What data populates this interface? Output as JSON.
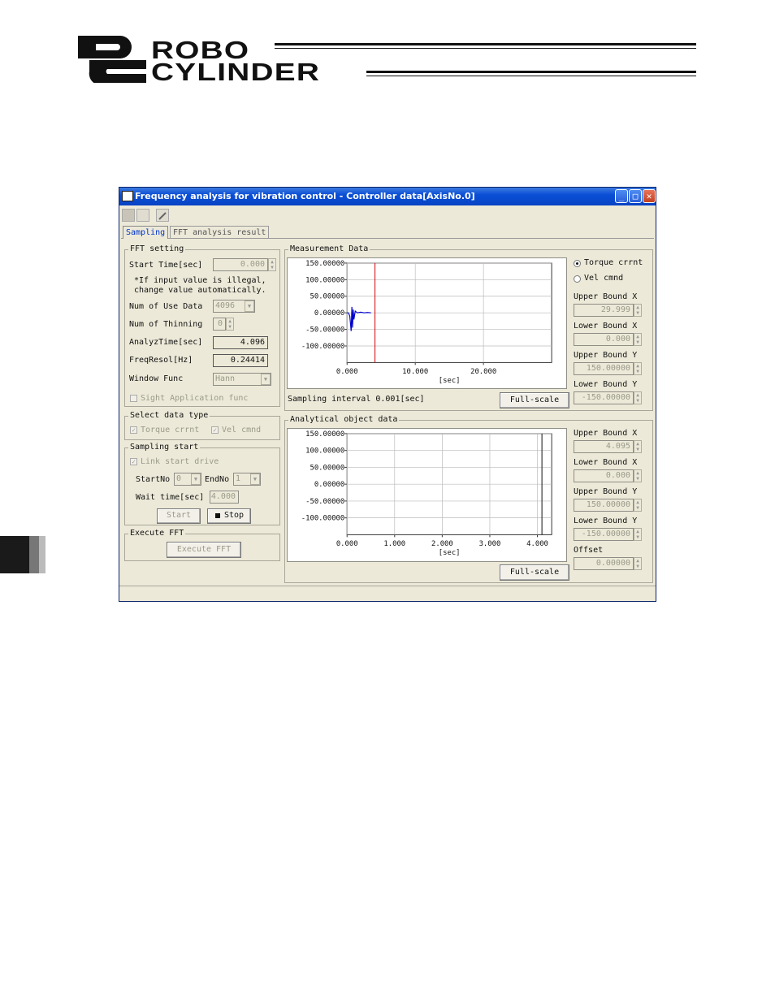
{
  "header": {
    "logo_line1": "ROBO",
    "logo_line2": "CYLINDER"
  },
  "window": {
    "title": "Frequency analysis for vibration control - Controller data[AxisNo.0]",
    "min_glyph": "_",
    "max_glyph": "□",
    "close_glyph": "✕",
    "tabs": [
      "Sampling",
      "FFT analysis result"
    ]
  },
  "fft_setting": {
    "group_title": "FFT setting",
    "start_time_label": "Start Time[sec]",
    "start_time_value": "0.000",
    "note_line1": "*If input value is illegal,",
    "note_line2": "change value automatically.",
    "num_use_data_label": "Num of Use Data",
    "num_use_data_value": "4096",
    "num_thinning_label": "Num of Thinning",
    "num_thinning_value": "0",
    "analyz_time_label": "AnalyzTime[sec]",
    "analyz_time_value": "4.096",
    "freq_resol_label": "FreqResol[Hz]",
    "freq_resol_value": "0.24414",
    "window_func_label": "Window Func",
    "window_func_value": "Hann",
    "sight_label": "Sight Application func"
  },
  "select_data_type": {
    "group_title": "Select data type",
    "torque_label": "Torque crrnt",
    "vel_label": "Vel cmnd"
  },
  "sampling_start": {
    "group_title": "Sampling start",
    "link_label": "Link start drive",
    "start_no_label": "StartNo",
    "start_no_value": "0",
    "end_no_label": "EndNo",
    "end_no_value": "1",
    "wait_label": "Wait time[sec]",
    "wait_value": "4.000",
    "start_button": "Start",
    "stop_button": "Stop"
  },
  "execute_fft": {
    "group_title": "Execute FFT",
    "button": "Execute FFT"
  },
  "measurement": {
    "group_title": "Measurement Data",
    "sampling_interval": "Sampling interval 0.001[sec]",
    "fullscale_button": "Full-scale",
    "radio_torque": "Torque crrnt",
    "radio_vel": "Vel cmnd",
    "upper_x_label": "Upper Bound X",
    "upper_x_value": "29.999",
    "lower_x_label": "Lower Bound X",
    "lower_x_value": "0.000",
    "upper_y_label": "Upper Bound Y",
    "upper_y_value": "150.00000",
    "lower_y_label": "Lower Bound Y",
    "lower_y_value": "-150.00000"
  },
  "analytical": {
    "group_title": "Analytical object data",
    "fullscale_button": "Full-scale",
    "upper_x_label": "Upper Bound X",
    "upper_x_value": "4.095",
    "lower_x_label": "Lower Bound X",
    "lower_x_value": "0.000",
    "upper_y_label": "Upper Bound Y",
    "upper_y_value": "150.00000",
    "lower_y_label": "Lower Bound Y",
    "lower_y_value": "-150.00000",
    "offset_label": "Offset",
    "offset_value": "0.00000"
  },
  "chart_data": [
    {
      "type": "line",
      "title": "Measurement Data",
      "xlabel": "[sec]",
      "ylabel": "",
      "xlim": [
        0,
        30
      ],
      "ylim": [
        -150,
        150
      ],
      "x_ticks": [
        "0.000",
        "10.000",
        "20.000"
      ],
      "y_ticks": [
        "150.00000",
        "100.00000",
        "50.00000",
        "0.00000",
        "-50.00000",
        "-100.00000"
      ],
      "marker_x": 4.095,
      "series": [
        {
          "color": "#0000cc",
          "x": [
            0.0,
            0.2,
            0.4,
            0.6,
            0.7,
            0.8,
            0.9,
            1.0,
            1.2,
            1.5,
            2.0,
            2.5,
            3.0,
            3.5
          ],
          "y": [
            0,
            0,
            -10,
            -55,
            18,
            -45,
            10,
            -20,
            5,
            0,
            2,
            0,
            1,
            0
          ]
        }
      ],
      "grid": true
    },
    {
      "type": "line",
      "title": "Analytical object data",
      "xlabel": "[sec]",
      "ylabel": "",
      "xlim": [
        0,
        4.3
      ],
      "ylim": [
        -150,
        150
      ],
      "x_ticks": [
        "0.000",
        "1.000",
        "2.000",
        "3.000",
        "4.000"
      ],
      "y_ticks": [
        "150.00000",
        "100.00000",
        "50.00000",
        "0.00000",
        "-50.00000",
        "-100.00000"
      ],
      "marker_x": 4.095,
      "series": [],
      "grid": true
    }
  ]
}
